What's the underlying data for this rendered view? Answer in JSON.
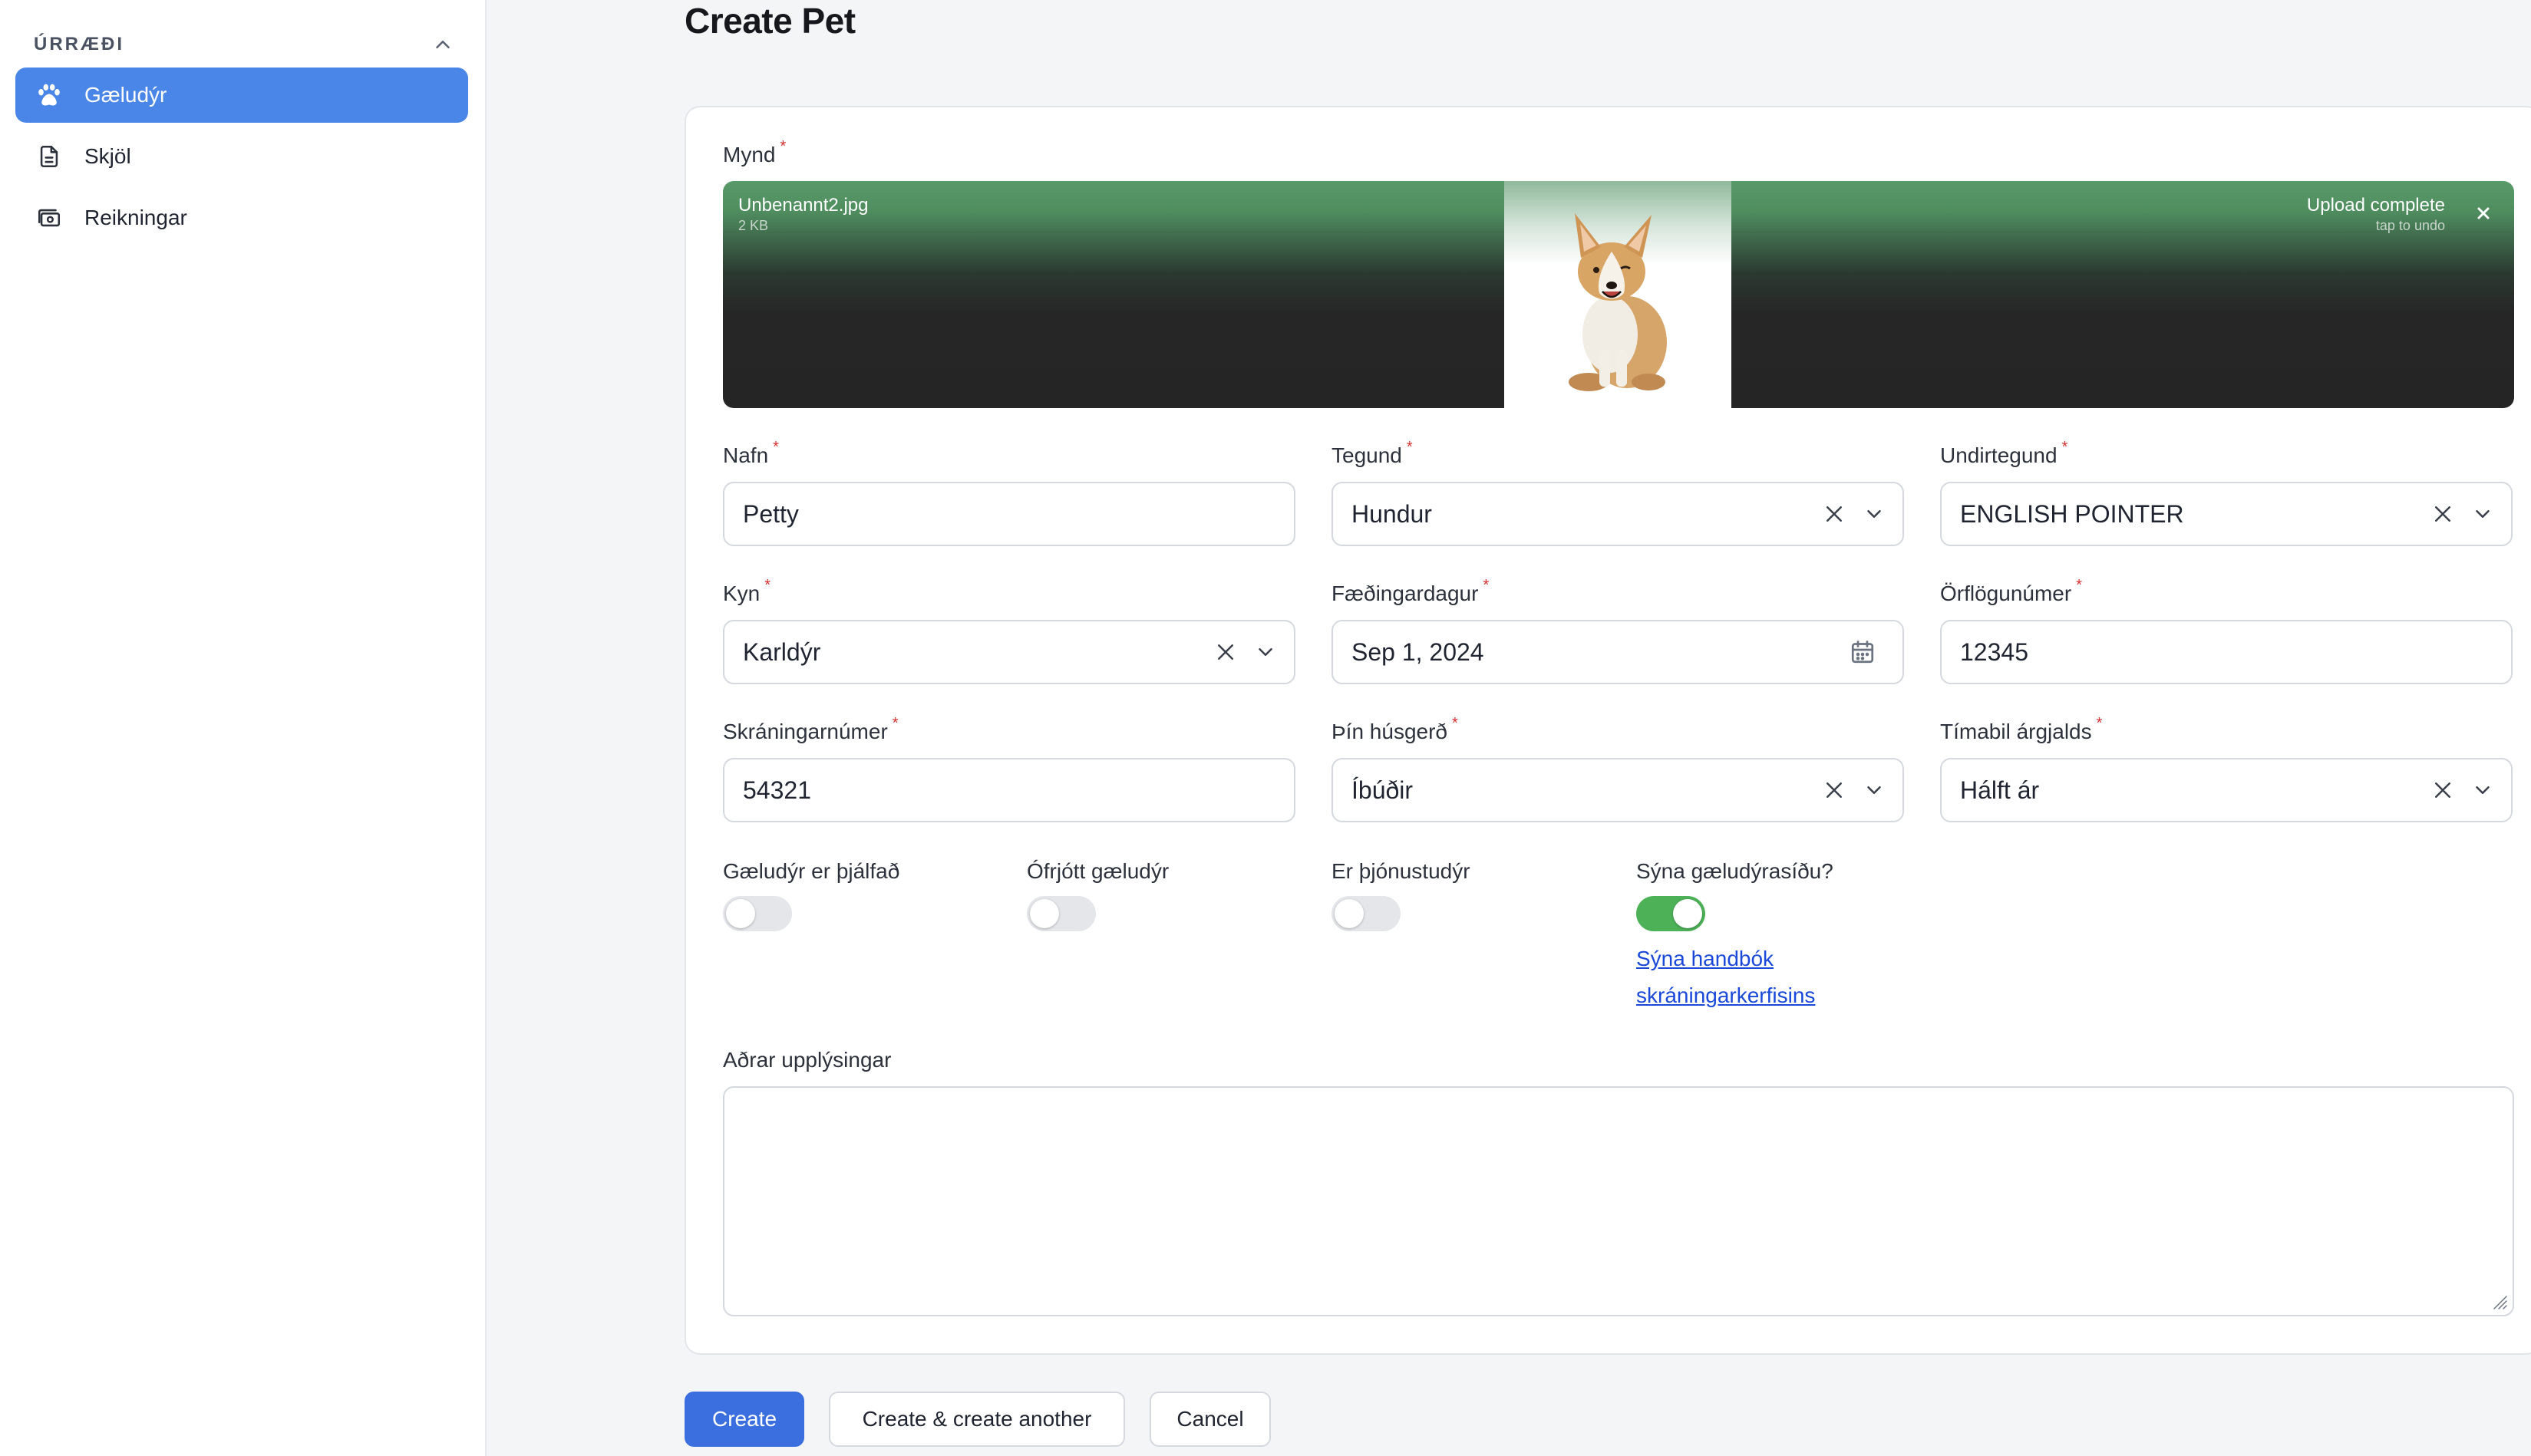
{
  "sidebar": {
    "group_title": "ÚRRÆÐI",
    "items": [
      {
        "label": "Gæludýr",
        "icon": "paw-icon",
        "active": true
      },
      {
        "label": "Skjöl",
        "icon": "document-icon",
        "active": false
      },
      {
        "label": "Reikningar",
        "icon": "cash-icon",
        "active": false
      }
    ]
  },
  "page": {
    "title": "Create Pet"
  },
  "form": {
    "image": {
      "label": "Mynd",
      "file_name": "Unbenannt2.jpg",
      "file_size": "2 KB",
      "status": "Upload complete",
      "undo_hint": "tap to undo"
    },
    "name": {
      "label": "Nafn",
      "value": "Petty"
    },
    "species": {
      "label": "Tegund",
      "value": "Hundur"
    },
    "breed": {
      "label": "Undirtegund",
      "value": "ENGLISH POINTER"
    },
    "sex": {
      "label": "Kyn",
      "value": "Karldýr"
    },
    "birthdate": {
      "label": "Fæðingardagur",
      "value": "Sep 1, 2024"
    },
    "chip_number": {
      "label": "Örflögunúmer",
      "value": "12345"
    },
    "registration_number": {
      "label": "Skráningarnúmer",
      "value": "54321"
    },
    "housing": {
      "label": "Þín húsgerð",
      "value": "Íbúðir"
    },
    "fee_period": {
      "label": "Tímabil árgjalds",
      "value": "Hálft ár"
    },
    "toggles": {
      "trained": {
        "label": "Gæludýr er þjálfað",
        "on": false
      },
      "unneutered": {
        "label": "Ófrjótt gæludýr",
        "on": false
      },
      "service_animal": {
        "label": "Er þjónustudýr",
        "on": false
      },
      "show_pet_page": {
        "label": "Sýna gæludýrasíðu?",
        "on": true
      }
    },
    "manual_link_line1": "Sýna handbók",
    "manual_link_line2": "skráningarkerfisins",
    "other_info": {
      "label": "Aðrar upplýsingar",
      "value": ""
    }
  },
  "actions": {
    "create": "Create",
    "create_another": "Create & create another",
    "cancel": "Cancel"
  },
  "colors": {
    "accent": "#3b6fe0",
    "sidebar_active": "#4a86e8",
    "toggle_on": "#4db158",
    "required": "#d3302f",
    "link": "#1a48d8"
  }
}
